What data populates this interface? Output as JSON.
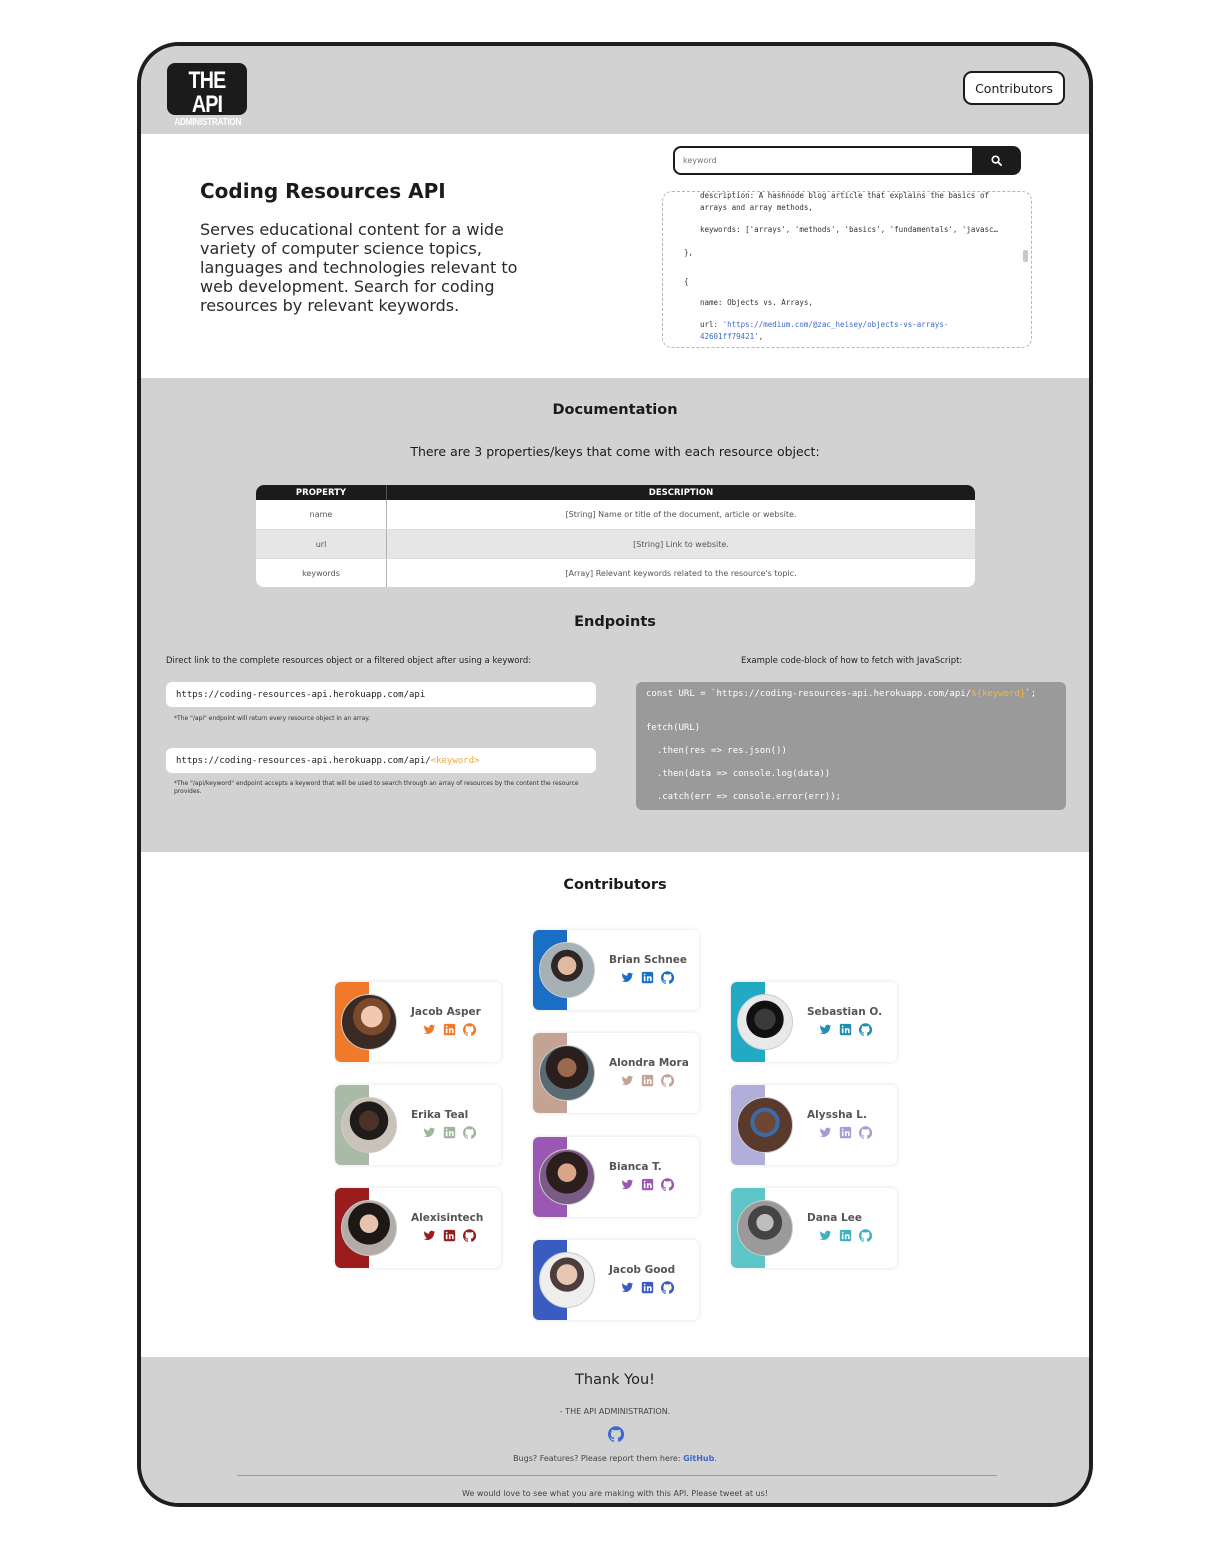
{
  "header": {
    "logo_line1": "THE API",
    "logo_line2": "ADMINISTRATION",
    "contributors_button": "Contributors"
  },
  "hero": {
    "title": "Coding Resources API",
    "description": "Serves educational content for a wide variety of computer science topics, languages and technologies relevant to web development. Search for coding resources by relevant keywords.",
    "search_placeholder": "keyword",
    "code_lines": [
      "description: A hashnode blog article that explains the basics of",
      "arrays and array methods,",
      "keywords: ['arrays', 'methods', 'basics', 'fundamentals', 'javasc…",
      "},",
      "{",
      "name: Objects vs. Arrays,",
      "url: ",
      "'https://medium.com/@zac_heisey/objects-vs-arrays-",
      "42601ff79421'",
      ","
    ]
  },
  "docs": {
    "title": "Documentation",
    "subtitle": "There are 3 properties/keys that come with each resource object:",
    "headers": [
      "PROPERTY",
      "DESCRIPTION"
    ],
    "rows": [
      {
        "property": "name",
        "description": "[String] Name or title of the document, article or website."
      },
      {
        "property": "url",
        "description": "[String] Link to website."
      },
      {
        "property": "keywords",
        "description": "[Array] Relevant keywords related to the resource's topic."
      }
    ]
  },
  "endpoints": {
    "title": "Endpoints",
    "left_label": "Direct link to the complete resources object or a filtered object after using a keyword:",
    "right_label": "Example code-block of how to fetch with JavaScript:",
    "url1": "https://coding-resources-api.herokuapp.com/api",
    "note1": "*The \"/api\" endpoint will return every resource object in an array.",
    "url2_base": "https://coding-resources-api.herokuapp.com/api/",
    "url2_kw": "<keyword>",
    "note2": "*The \"/api/keyword\" endpoint accepts a keyword that will be used to search through an array of resources by the content the resource provides.",
    "code": {
      "l1a": "const URL = `https://coding-resources-api.herokuapp.com/api/",
      "l1kw": "${keyword}",
      "l1b": "`;",
      "l2": "fetch(URL)",
      "l3": "  .then(res => res.json())",
      "l4": "  .then(data => console.log(data))",
      "l5": "  .catch(err => console.error(err));"
    }
  },
  "contributors": {
    "title": "Contributors",
    "people": [
      {
        "name": "Jacob Asper",
        "color": "#f07a2a",
        "icon_color": "#f07a2a"
      },
      {
        "name": "Erika Teal",
        "color": "#a9bba7",
        "icon_color": "#a0b59e"
      },
      {
        "name": "Alexisintech",
        "color": "#9b1c1c",
        "icon_color": "#9b1c1c"
      },
      {
        "name": "Brian Schnee",
        "color": "#1a6fc4",
        "icon_color": "#1a6fc4"
      },
      {
        "name": "Alondra Mora",
        "color": "#c4a395",
        "icon_color": "#c4a395"
      },
      {
        "name": "Bianca T.",
        "color": "#9a58b4",
        "icon_color": "#9a58b4"
      },
      {
        "name": "Jacob Good",
        "color": "#3a5bbf",
        "icon_color": "#3a5bbf"
      },
      {
        "name": "Sebastian O.",
        "color": "#22a9c4",
        "icon_color": "#1d8fb3"
      },
      {
        "name": "Alyssha L.",
        "color": "#b1aedb",
        "icon_color": "#a09ed6"
      },
      {
        "name": "Dana Lee",
        "color": "#5ec6c9",
        "icon_color": "#3fb0c2"
      }
    ]
  },
  "footer": {
    "thanks": "Thank You!",
    "signature": "- THE API ADMINISTRATION.",
    "bugs_text": "Bugs? Features? Please report them here: ",
    "bugs_link": "GitHub",
    "bugs_end": ".",
    "tweet": "We would love to see what you are making with this API. Please tweet at us!"
  }
}
